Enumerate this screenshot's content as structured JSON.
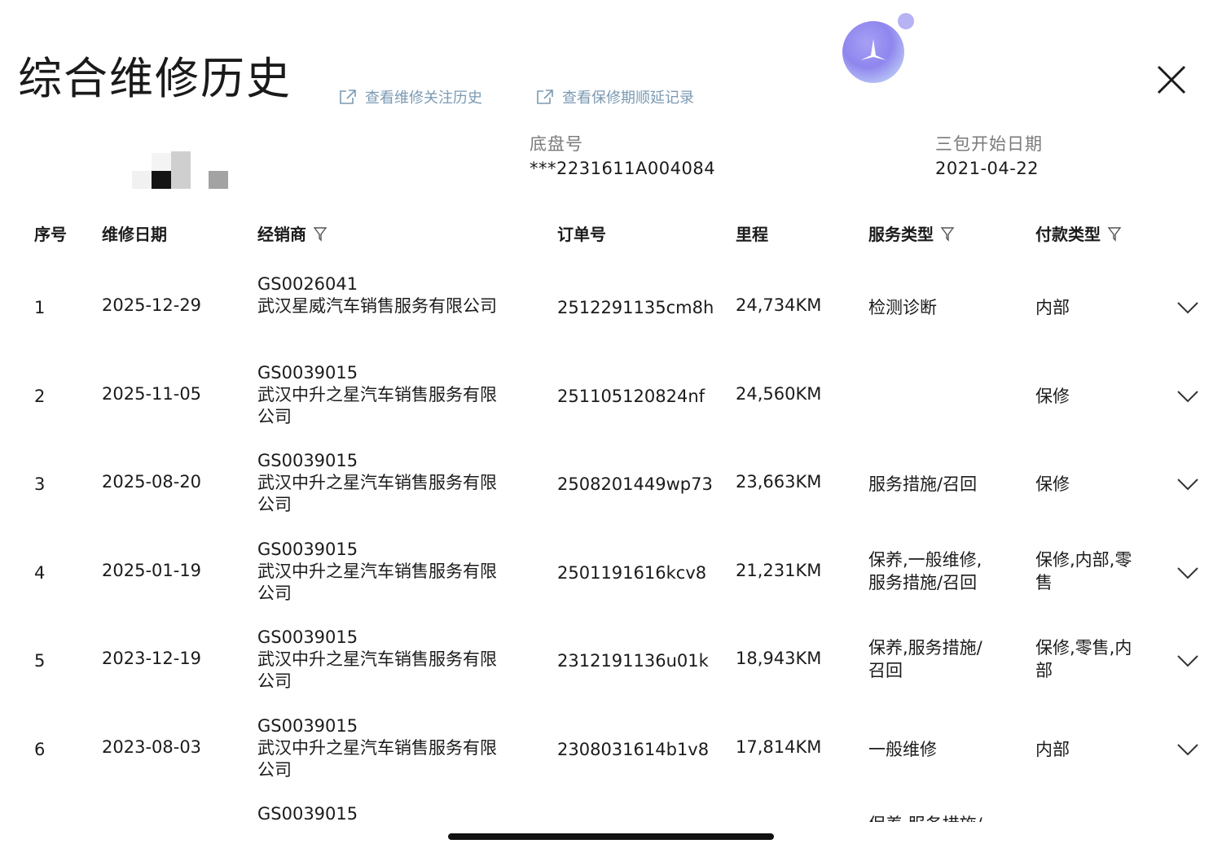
{
  "header": {
    "title": "综合维修历史",
    "links": [
      {
        "label": "查看维修关注历史",
        "icon": "external-link-icon"
      },
      {
        "label": "查看保修期顺延记录",
        "icon": "external-link-icon"
      }
    ],
    "assistant_icon": "assistant-orb-icon",
    "close_icon": "close-icon"
  },
  "vehicle": {
    "chassis_label": "底盘号",
    "chassis_value": "***2231611A004084",
    "warranty_label": "三包开始日期",
    "warranty_value": "2021-04-22"
  },
  "table": {
    "columns": [
      {
        "label": "序号",
        "filter": false
      },
      {
        "label": "维修日期",
        "filter": false
      },
      {
        "label": "经销商",
        "filter": true
      },
      {
        "label": "订单号",
        "filter": false
      },
      {
        "label": "里程",
        "filter": false
      },
      {
        "label": "服务类型",
        "filter": true
      },
      {
        "label": "付款类型",
        "filter": true
      }
    ],
    "rows": [
      {
        "index": "1",
        "date": "2025-12-29",
        "dealer_code": "GS0026041",
        "dealer_name": "武汉星威汽车销售服务有限公司",
        "order": "2512291135cm8h",
        "mileage": "24,734KM",
        "service": "检测诊断",
        "payment": "内部"
      },
      {
        "index": "2",
        "date": "2025-11-05",
        "dealer_code": "GS0039015",
        "dealer_name": "武汉中升之星汽车销售服务有限公司",
        "order": "251105120824nf",
        "mileage": "24,560KM",
        "service": "",
        "payment": "保修"
      },
      {
        "index": "3",
        "date": "2025-08-20",
        "dealer_code": "GS0039015",
        "dealer_name": "武汉中升之星汽车销售服务有限公司",
        "order": "2508201449wp73",
        "mileage": "23,663KM",
        "service": "服务措施/召回",
        "payment": "保修"
      },
      {
        "index": "4",
        "date": "2025-01-19",
        "dealer_code": "GS0039015",
        "dealer_name": "武汉中升之星汽车销售服务有限公司",
        "order": "2501191616kcv8",
        "mileage": "21,231KM",
        "service": "保养,一般维修,服务措施/召回",
        "payment": "保修,内部,零售"
      },
      {
        "index": "5",
        "date": "2023-12-19",
        "dealer_code": "GS0039015",
        "dealer_name": "武汉中升之星汽车销售服务有限公司",
        "order": "2312191136u01k",
        "mileage": "18,943KM",
        "service": "保养,服务措施/召回",
        "payment": "保修,零售,内部"
      },
      {
        "index": "6",
        "date": "2023-08-03",
        "dealer_code": "GS0039015",
        "dealer_name": "武汉中升之星汽车销售服务有限公司",
        "order": "2308031614b1v8",
        "mileage": "17,814KM",
        "service": "一般维修",
        "payment": "内部"
      },
      {
        "index": "",
        "date": "",
        "dealer_code": "GS0039015",
        "dealer_name": "",
        "order": "",
        "mileage": "",
        "service": "保养,服务措施/",
        "payment": ""
      }
    ]
  },
  "colors": {
    "link": "#7b9ab3",
    "label": "#7a7a7a",
    "text": "#1b1b1b",
    "assistant": "#8f86ee"
  }
}
